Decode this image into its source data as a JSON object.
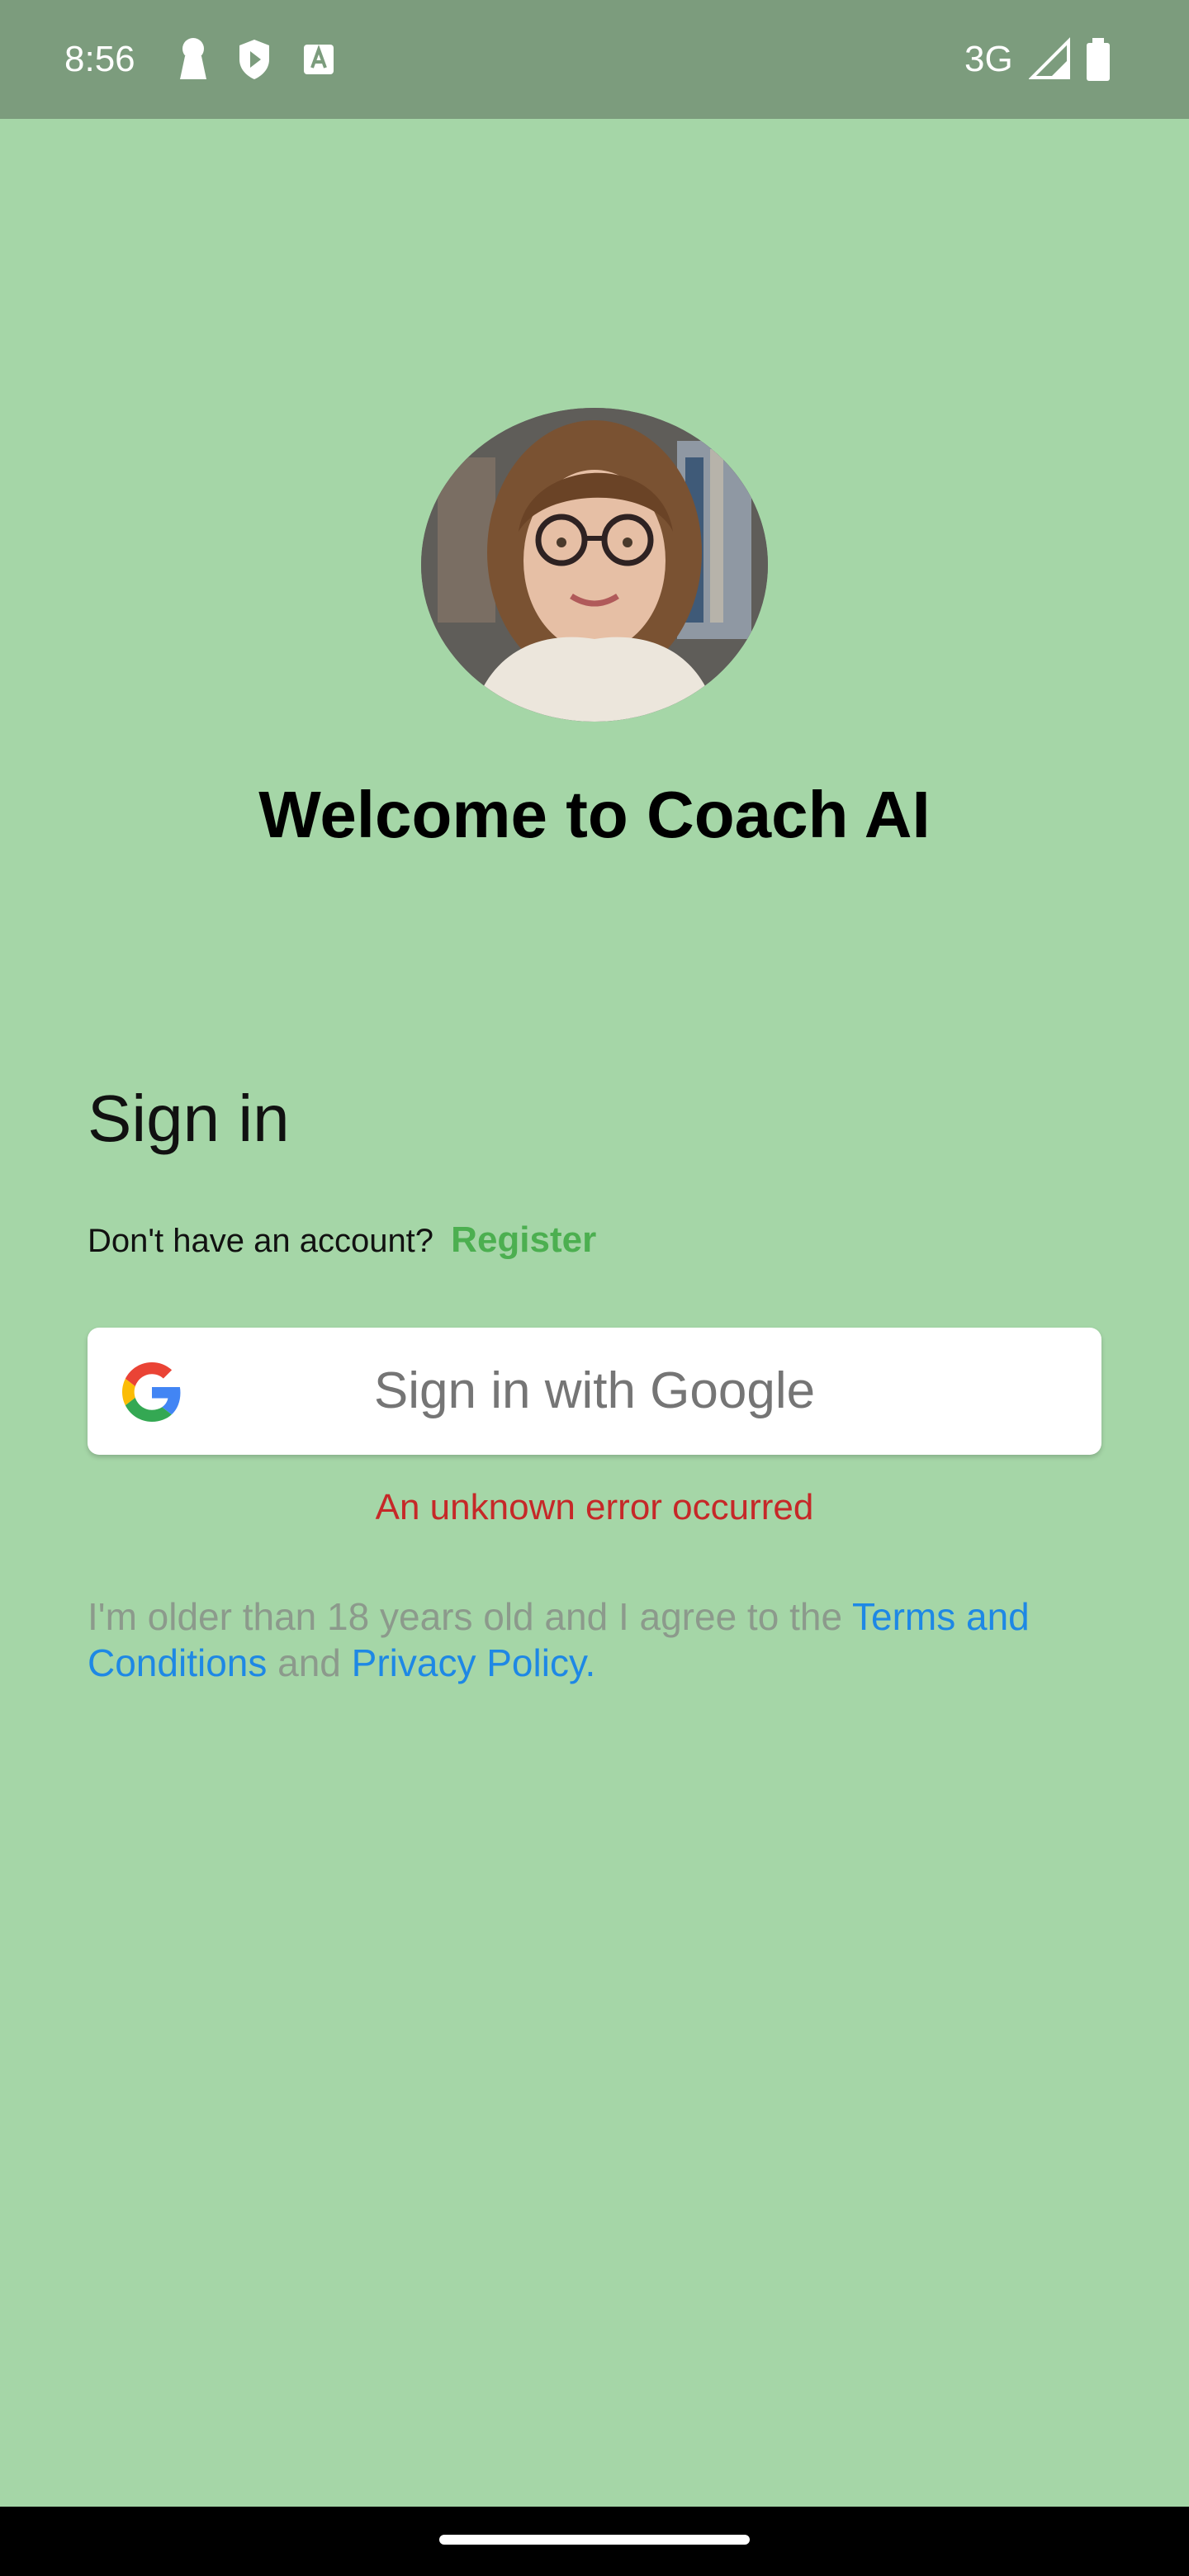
{
  "status_bar": {
    "time": "8:56",
    "network": "3G",
    "icons": [
      "keyhole-icon",
      "shield-play-icon",
      "font-icon",
      "signal-icon",
      "battery-icon"
    ]
  },
  "welcome": {
    "title": "Welcome to Coach AI",
    "avatar": "coach-avatar-photo"
  },
  "signin": {
    "heading": "Sign in",
    "account_prompt": "Don't have an account?",
    "register_label": "Register",
    "google_button_label": "Sign in with Google",
    "error_message": "An unknown error occurred"
  },
  "terms": {
    "prefix": "I'm older than 18 years old and I agree to the ",
    "terms_link": "Terms and Conditions",
    "middle": " and ",
    "privacy_link": "Privacy Policy."
  },
  "colors": {
    "background": "#a5d6a7",
    "status_bar": "#7c9c7d",
    "register": "#4caf50",
    "error": "#c62828",
    "link": "#1e88e5",
    "muted": "#8c9a8c"
  }
}
